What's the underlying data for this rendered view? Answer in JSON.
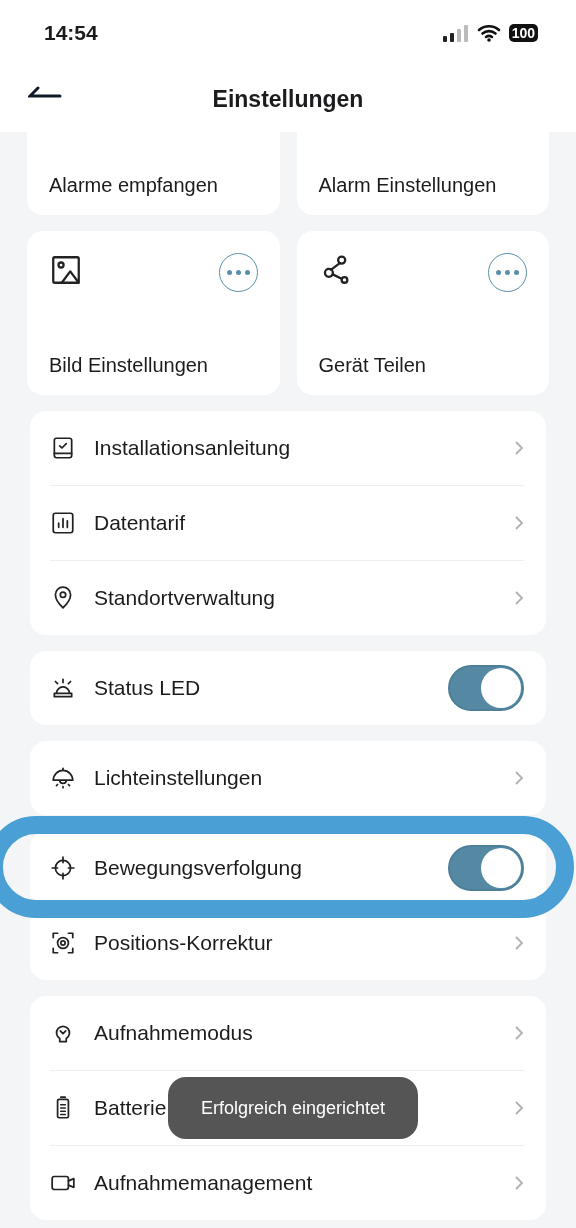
{
  "status_bar": {
    "time": "14:54",
    "battery": "100"
  },
  "header": {
    "title": "Einstellungen"
  },
  "tiles": [
    {
      "label": "Alarme empfangen"
    },
    {
      "label": "Alarm Einstellungen"
    },
    {
      "label": "Bild Einstellungen"
    },
    {
      "label": "Gerät Teilen"
    }
  ],
  "groups": [
    {
      "rows": [
        {
          "label": "Installationsanleitung",
          "kind": "link"
        },
        {
          "label": "Datentarif",
          "kind": "link"
        },
        {
          "label": "Standortverwaltung",
          "kind": "link"
        }
      ]
    },
    {
      "rows": [
        {
          "label": "Status LED",
          "kind": "toggle",
          "on": true
        }
      ]
    },
    {
      "rows": [
        {
          "label": "Lichteinstellungen",
          "kind": "link"
        }
      ]
    },
    {
      "rows": [
        {
          "label": "Bewegungsverfolgung",
          "kind": "toggle",
          "on": true,
          "highlighted": true
        },
        {
          "label": "Positions-Korrektur",
          "kind": "link"
        }
      ]
    },
    {
      "rows": [
        {
          "label": "Aufnahmemodus",
          "kind": "link"
        },
        {
          "label": "Batterie",
          "kind": "link"
        },
        {
          "label": "Aufnahmemanagement",
          "kind": "link"
        }
      ]
    }
  ],
  "toast": {
    "text": "Erfolgreich eingerichtet"
  }
}
